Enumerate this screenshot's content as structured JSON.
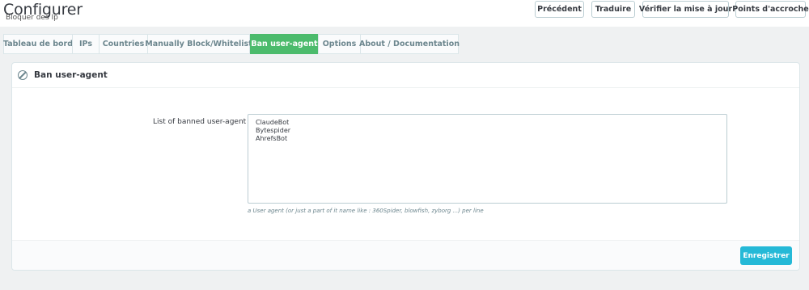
{
  "header": {
    "title": "Configurer",
    "subtitle": "Bloquer des Ip",
    "buttons": [
      "Précédent",
      "Traduire",
      "Vérifier la mise à jour",
      "Points d'accroche"
    ]
  },
  "tabs": [
    {
      "label": "Tableau de bord",
      "active": false
    },
    {
      "label": "IPs",
      "active": false
    },
    {
      "label": "Countries",
      "active": false
    },
    {
      "label": "Manually Block/Whitelist",
      "active": false
    },
    {
      "label": "Ban user-agent",
      "active": true
    },
    {
      "label": "Options",
      "active": false
    },
    {
      "label": "About / Documentation",
      "active": false
    }
  ],
  "panel": {
    "icon": "ban-icon",
    "title": "Ban user-agent",
    "field_label": "List of banned user-agent",
    "user_agents": [
      "ClaudeBot",
      "Bytespider",
      "AhrefsBot"
    ],
    "help_text": "a User agent (or just a part of it name like : 360Spider, blowfish, zyborg ...) per line",
    "save_label": "Enregistrer"
  },
  "colors": {
    "accent_green": "#4cbb6c",
    "primary_blue": "#25b9d7",
    "background": "#eff1f2"
  }
}
